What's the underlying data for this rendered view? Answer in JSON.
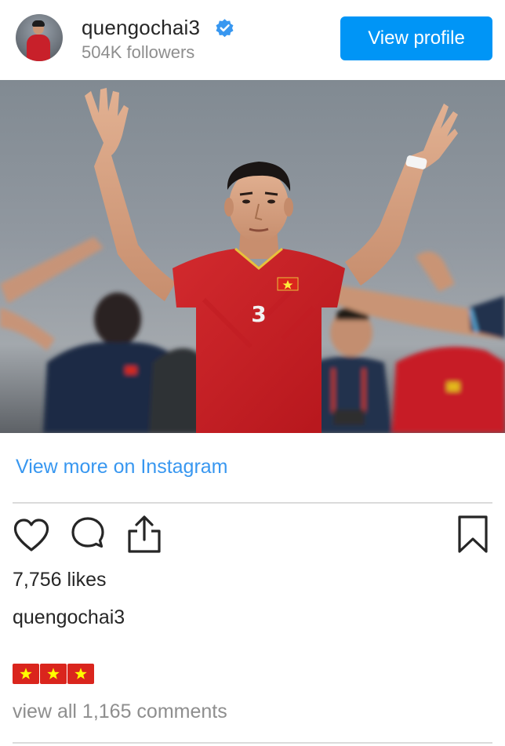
{
  "header": {
    "username": "quengochai3",
    "verified": true,
    "followers": "504K followers",
    "view_profile_label": "View profile"
  },
  "post": {
    "photo_icon": "photo-of-football-player",
    "view_more_label": "View more on Instagram",
    "likes": "7,756 likes",
    "caption_user": "quengochai3",
    "caption_flags": [
      "🇻🇳",
      "🇻🇳",
      "🇻🇳"
    ],
    "view_comments_label": "view all 1,165 comments"
  },
  "actions": {
    "like_icon": "heart-icon",
    "comment_icon": "comment-icon",
    "share_icon": "share-icon",
    "save_icon": "bookmark-icon"
  },
  "colors": {
    "brand_blue": "#0095f6",
    "link_blue": "#3897f0",
    "text": "#262626",
    "muted": "#8e8e8e",
    "divider": "#dbdbdb",
    "flag_red": "#da251d",
    "flag_star": "#ffff00"
  }
}
